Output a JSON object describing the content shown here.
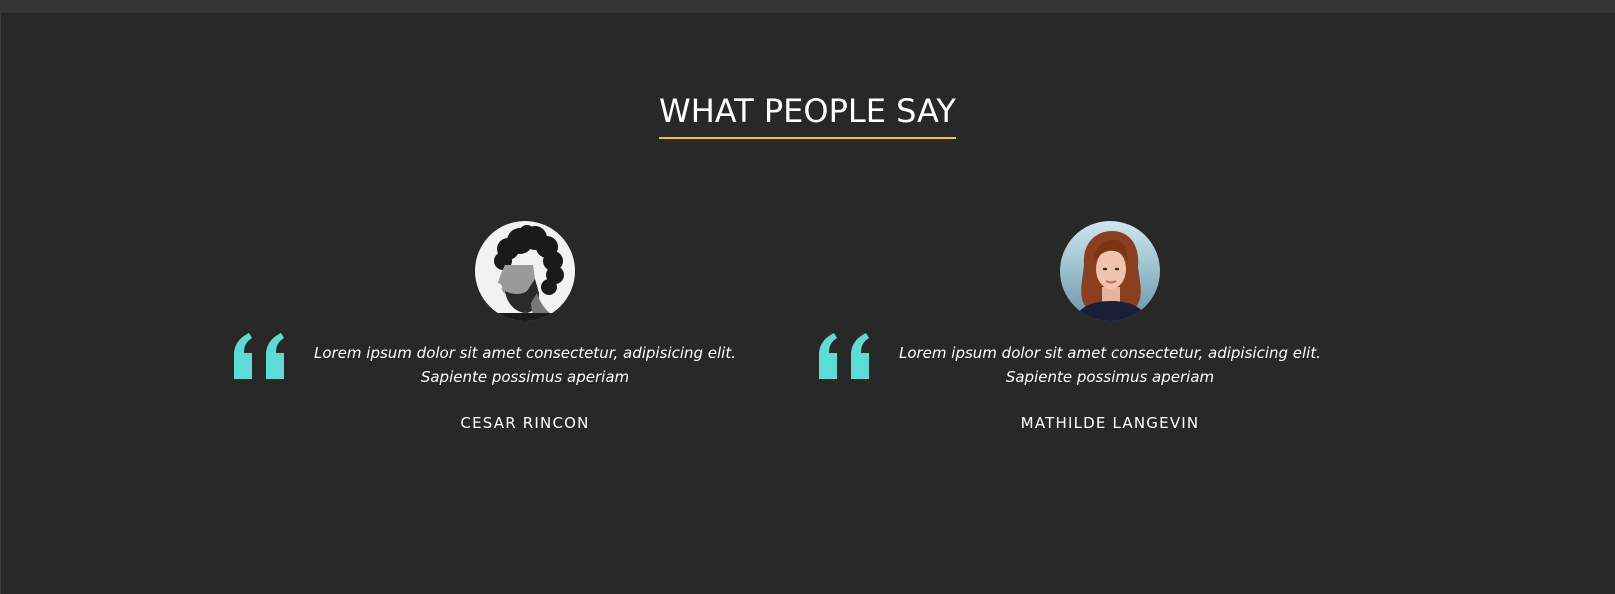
{
  "section": {
    "title": "WHAT PEOPLE SAY"
  },
  "colors": {
    "background": "#282828",
    "accent_underline": "#f2c230",
    "quote_icon": "#5ddcd6",
    "text": "#ffffff"
  },
  "testimonials": [
    {
      "quote": "Lorem ipsum dolor sit amet consectetur, adipisicing elit. Sapiente possimus aperiam",
      "name": "CESAR RINCON",
      "avatar_icon": "man-portrait-photo"
    },
    {
      "quote": "Lorem ipsum dolor sit amet consectetur, adipisicing elit. Sapiente possimus aperiam",
      "name": "MATHILDE LANGEVIN",
      "avatar_icon": "woman-portrait-photo"
    }
  ]
}
